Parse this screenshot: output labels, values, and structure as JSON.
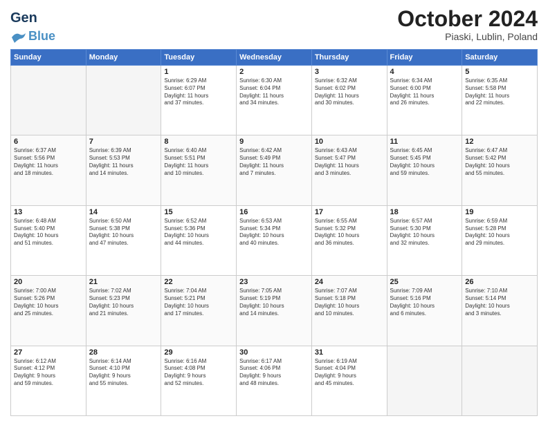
{
  "header": {
    "logo_line1": "General",
    "logo_line2": "Blue",
    "month": "October 2024",
    "location": "Piaski, Lublin, Poland"
  },
  "weekdays": [
    "Sunday",
    "Monday",
    "Tuesday",
    "Wednesday",
    "Thursday",
    "Friday",
    "Saturday"
  ],
  "weeks": [
    [
      {
        "day": "",
        "detail": ""
      },
      {
        "day": "",
        "detail": ""
      },
      {
        "day": "1",
        "detail": "Sunrise: 6:29 AM\nSunset: 6:07 PM\nDaylight: 11 hours\nand 37 minutes."
      },
      {
        "day": "2",
        "detail": "Sunrise: 6:30 AM\nSunset: 6:04 PM\nDaylight: 11 hours\nand 34 minutes."
      },
      {
        "day": "3",
        "detail": "Sunrise: 6:32 AM\nSunset: 6:02 PM\nDaylight: 11 hours\nand 30 minutes."
      },
      {
        "day": "4",
        "detail": "Sunrise: 6:34 AM\nSunset: 6:00 PM\nDaylight: 11 hours\nand 26 minutes."
      },
      {
        "day": "5",
        "detail": "Sunrise: 6:35 AM\nSunset: 5:58 PM\nDaylight: 11 hours\nand 22 minutes."
      }
    ],
    [
      {
        "day": "6",
        "detail": "Sunrise: 6:37 AM\nSunset: 5:56 PM\nDaylight: 11 hours\nand 18 minutes."
      },
      {
        "day": "7",
        "detail": "Sunrise: 6:39 AM\nSunset: 5:53 PM\nDaylight: 11 hours\nand 14 minutes."
      },
      {
        "day": "8",
        "detail": "Sunrise: 6:40 AM\nSunset: 5:51 PM\nDaylight: 11 hours\nand 10 minutes."
      },
      {
        "day": "9",
        "detail": "Sunrise: 6:42 AM\nSunset: 5:49 PM\nDaylight: 11 hours\nand 7 minutes."
      },
      {
        "day": "10",
        "detail": "Sunrise: 6:43 AM\nSunset: 5:47 PM\nDaylight: 11 hours\nand 3 minutes."
      },
      {
        "day": "11",
        "detail": "Sunrise: 6:45 AM\nSunset: 5:45 PM\nDaylight: 10 hours\nand 59 minutes."
      },
      {
        "day": "12",
        "detail": "Sunrise: 6:47 AM\nSunset: 5:42 PM\nDaylight: 10 hours\nand 55 minutes."
      }
    ],
    [
      {
        "day": "13",
        "detail": "Sunrise: 6:48 AM\nSunset: 5:40 PM\nDaylight: 10 hours\nand 51 minutes."
      },
      {
        "day": "14",
        "detail": "Sunrise: 6:50 AM\nSunset: 5:38 PM\nDaylight: 10 hours\nand 47 minutes."
      },
      {
        "day": "15",
        "detail": "Sunrise: 6:52 AM\nSunset: 5:36 PM\nDaylight: 10 hours\nand 44 minutes."
      },
      {
        "day": "16",
        "detail": "Sunrise: 6:53 AM\nSunset: 5:34 PM\nDaylight: 10 hours\nand 40 minutes."
      },
      {
        "day": "17",
        "detail": "Sunrise: 6:55 AM\nSunset: 5:32 PM\nDaylight: 10 hours\nand 36 minutes."
      },
      {
        "day": "18",
        "detail": "Sunrise: 6:57 AM\nSunset: 5:30 PM\nDaylight: 10 hours\nand 32 minutes."
      },
      {
        "day": "19",
        "detail": "Sunrise: 6:59 AM\nSunset: 5:28 PM\nDaylight: 10 hours\nand 29 minutes."
      }
    ],
    [
      {
        "day": "20",
        "detail": "Sunrise: 7:00 AM\nSunset: 5:26 PM\nDaylight: 10 hours\nand 25 minutes."
      },
      {
        "day": "21",
        "detail": "Sunrise: 7:02 AM\nSunset: 5:23 PM\nDaylight: 10 hours\nand 21 minutes."
      },
      {
        "day": "22",
        "detail": "Sunrise: 7:04 AM\nSunset: 5:21 PM\nDaylight: 10 hours\nand 17 minutes."
      },
      {
        "day": "23",
        "detail": "Sunrise: 7:05 AM\nSunset: 5:19 PM\nDaylight: 10 hours\nand 14 minutes."
      },
      {
        "day": "24",
        "detail": "Sunrise: 7:07 AM\nSunset: 5:18 PM\nDaylight: 10 hours\nand 10 minutes."
      },
      {
        "day": "25",
        "detail": "Sunrise: 7:09 AM\nSunset: 5:16 PM\nDaylight: 10 hours\nand 6 minutes."
      },
      {
        "day": "26",
        "detail": "Sunrise: 7:10 AM\nSunset: 5:14 PM\nDaylight: 10 hours\nand 3 minutes."
      }
    ],
    [
      {
        "day": "27",
        "detail": "Sunrise: 6:12 AM\nSunset: 4:12 PM\nDaylight: 9 hours\nand 59 minutes."
      },
      {
        "day": "28",
        "detail": "Sunrise: 6:14 AM\nSunset: 4:10 PM\nDaylight: 9 hours\nand 55 minutes."
      },
      {
        "day": "29",
        "detail": "Sunrise: 6:16 AM\nSunset: 4:08 PM\nDaylight: 9 hours\nand 52 minutes."
      },
      {
        "day": "30",
        "detail": "Sunrise: 6:17 AM\nSunset: 4:06 PM\nDaylight: 9 hours\nand 48 minutes."
      },
      {
        "day": "31",
        "detail": "Sunrise: 6:19 AM\nSunset: 4:04 PM\nDaylight: 9 hours\nand 45 minutes."
      },
      {
        "day": "",
        "detail": ""
      },
      {
        "day": "",
        "detail": ""
      }
    ]
  ]
}
